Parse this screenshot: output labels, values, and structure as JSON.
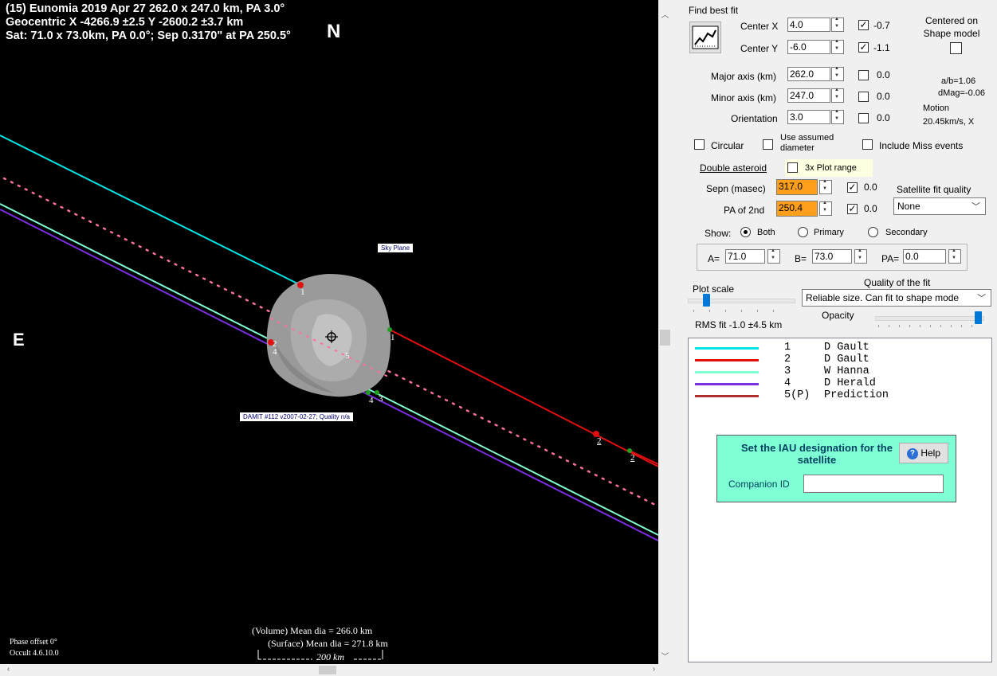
{
  "plot": {
    "header_line1": "(15) Eunomia  2019 Apr 27   262.0 x 247.0 km, PA 3.0°",
    "header_line2": "Geocentric  X  -4266.9 ±2.5  Y -2600.2 ±3.7 km",
    "header_line3": "Sat:  71.0 x 73.0km, PA 0.0°; Sep 0.3170\" at PA 250.5°",
    "north": "N",
    "east": "E",
    "sky_plane_label": "Sky Plane",
    "damit_label": "DAMIT #112 v2007-02-27; Quality n/a",
    "phase_offset": "Phase offset 0°",
    "version": "Occult 4.6.10.0",
    "mean_dia_volume": "(Volume) Mean dia = 266.0 km",
    "mean_dia_surface": "(Surface) Mean dia = 271.8 km",
    "scale_bar": "200 km",
    "chord_labels": {
      "cyan_d": "1",
      "red_d": "1",
      "red_r": "2",
      "red_r2": "2",
      "red_left": "2",
      "purple_left": "4",
      "green_d1": "4",
      "green_d2": "3",
      "center": "5"
    },
    "colors": {
      "cyan": "#00e5e5",
      "red": "#e01010",
      "mint": "#80ffd0",
      "purple": "#7a2ee0",
      "prediction": "#ff70a0",
      "shape": "#9a9a9a"
    }
  },
  "panel": {
    "find_best_fit": "Find best fit",
    "center_x_label": "Center X",
    "center_x_value": "4.0",
    "center_x_fit": "-0.7",
    "center_y_label": "Center Y",
    "center_y_value": "-6.0",
    "center_y_fit": "-1.1",
    "centered_on_shape": "Centered on Shape model",
    "major_label": "Major axis (km)",
    "major_value": "262.0",
    "major_fit": "0.0",
    "minor_label": "Minor axis (km)",
    "minor_value": "247.0",
    "minor_fit": "0.0",
    "orient_label": "Orientation",
    "orient_value": "3.0",
    "orient_fit": "0.0",
    "ab_ratio": "a/b=1.06",
    "dmag": "dMag=-0.06",
    "motion_label": "Motion",
    "motion_value": "20.45km/s, X",
    "circular": "Circular",
    "use_assumed": "Use assumed diameter",
    "include_miss": "Include Miss events",
    "double_asteroid": "Double asteroid",
    "plot_range_3x": "3x Plot range",
    "sepn_label": "Sepn (masec)",
    "sepn_value": "317.0",
    "sepn_fit": "0.0",
    "pa2_label": "PA of 2nd",
    "pa2_value": "250.4",
    "pa2_fit": "0.0",
    "sat_fit_quality_label": "Satellite fit quality",
    "sat_fit_quality_value": "None",
    "show_label": "Show:",
    "show_both": "Both",
    "show_primary": "Primary",
    "show_secondary": "Secondary",
    "a_label": "A=",
    "a_value": "71.0",
    "b_label": "B=",
    "b_value": "73.0",
    "pa_label": "PA=",
    "pa_value": "0.0",
    "plot_scale": "Plot scale",
    "quality_label": "Quality of the fit",
    "quality_value": "Reliable size. Can fit to shape mode",
    "rms_fit": "RMS fit -1.0 ±4.5 km",
    "opacity": "Opacity",
    "observers": [
      {
        "num": "1",
        "name": "D Gault",
        "color": "#00e5e5"
      },
      {
        "num": "2",
        "name": "D Gault",
        "color": "#e01010"
      },
      {
        "num": "3",
        "name": "W Hanna",
        "color": "#80ffd0"
      },
      {
        "num": "4",
        "name": "D Herald",
        "color": "#7a2ee0"
      },
      {
        "num": "5(P)",
        "name": "Prediction",
        "color": "#b03030"
      }
    ],
    "iau_title": "Set the IAU designation for the satellite",
    "help_button": "Help",
    "companion_id_label": "Companion ID",
    "companion_id_value": ""
  }
}
